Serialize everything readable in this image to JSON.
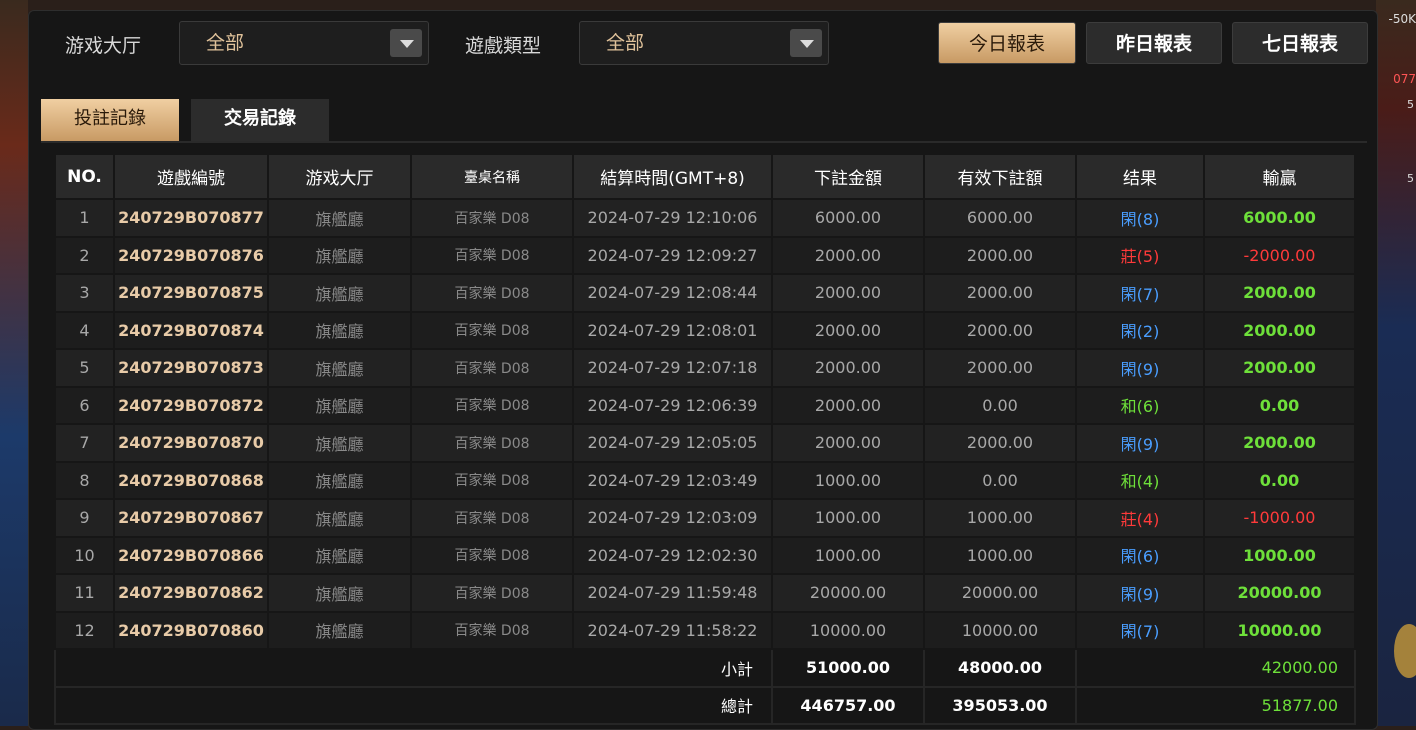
{
  "filters": {
    "hall_label": "游戏大厅",
    "hall_value": "全部",
    "type_label": "遊戲類型",
    "type_value": "全部"
  },
  "report_buttons": [
    "今日報表",
    "昨日報表",
    "七日報表"
  ],
  "tabs": [
    "投註記錄",
    "交易記錄"
  ],
  "table": {
    "headers": [
      "NO.",
      "遊戲編號",
      "游戏大厅",
      "臺桌名稱",
      "結算時間(GMT+8)",
      "下註金額",
      "有效下註額",
      "结果",
      "輸贏"
    ],
    "rows": [
      [
        "1",
        "240729B070877",
        "旗艦廳",
        "百家樂 D08",
        "2024-07-29 12:10:06",
        "6000.00",
        "6000.00",
        "閑(8)",
        "6000.00"
      ],
      [
        "2",
        "240729B070876",
        "旗艦廳",
        "百家樂 D08",
        "2024-07-29 12:09:27",
        "2000.00",
        "2000.00",
        "莊(5)",
        "-2000.00"
      ],
      [
        "3",
        "240729B070875",
        "旗艦廳",
        "百家樂 D08",
        "2024-07-29 12:08:44",
        "2000.00",
        "2000.00",
        "閑(7)",
        "2000.00"
      ],
      [
        "4",
        "240729B070874",
        "旗艦廳",
        "百家樂 D08",
        "2024-07-29 12:08:01",
        "2000.00",
        "2000.00",
        "閑(2)",
        "2000.00"
      ],
      [
        "5",
        "240729B070873",
        "旗艦廳",
        "百家樂 D08",
        "2024-07-29 12:07:18",
        "2000.00",
        "2000.00",
        "閑(9)",
        "2000.00"
      ],
      [
        "6",
        "240729B070872",
        "旗艦廳",
        "百家樂 D08",
        "2024-07-29 12:06:39",
        "2000.00",
        "0.00",
        "和(6)",
        "0.00"
      ],
      [
        "7",
        "240729B070870",
        "旗艦廳",
        "百家樂 D08",
        "2024-07-29 12:05:05",
        "2000.00",
        "2000.00",
        "閑(9)",
        "2000.00"
      ],
      [
        "8",
        "240729B070868",
        "旗艦廳",
        "百家樂 D08",
        "2024-07-29 12:03:49",
        "1000.00",
        "0.00",
        "和(4)",
        "0.00"
      ],
      [
        "9",
        "240729B070867",
        "旗艦廳",
        "百家樂 D08",
        "2024-07-29 12:03:09",
        "1000.00",
        "1000.00",
        "莊(4)",
        "-1000.00"
      ],
      [
        "10",
        "240729B070866",
        "旗艦廳",
        "百家樂 D08",
        "2024-07-29 12:02:30",
        "1000.00",
        "1000.00",
        "閑(6)",
        "1000.00"
      ],
      [
        "11",
        "240729B070862",
        "旗艦廳",
        "百家樂 D08",
        "2024-07-29 11:59:48",
        "20000.00",
        "20000.00",
        "閑(9)",
        "20000.00"
      ],
      [
        "12",
        "240729B070860",
        "旗艦廳",
        "百家樂 D08",
        "2024-07-29 11:58:22",
        "10000.00",
        "10000.00",
        "閑(7)",
        "10000.00"
      ]
    ],
    "subtotal": {
      "label": "小計",
      "bet": "51000.00",
      "valid": "48000.00",
      "winloss": "42000.00"
    },
    "total": {
      "label": "總計",
      "bet": "446757.00",
      "valid": "395053.00",
      "winloss": "51877.00"
    }
  },
  "background": {
    "right_text_1": "-50K",
    "right_text_2": "077",
    "right_text_3": "5"
  },
  "colors": {
    "accent_gold": "#e0bd8e",
    "win_green": "#6ee03a",
    "loss_red": "#ff3a3a",
    "player_blue": "#4a9eff"
  }
}
